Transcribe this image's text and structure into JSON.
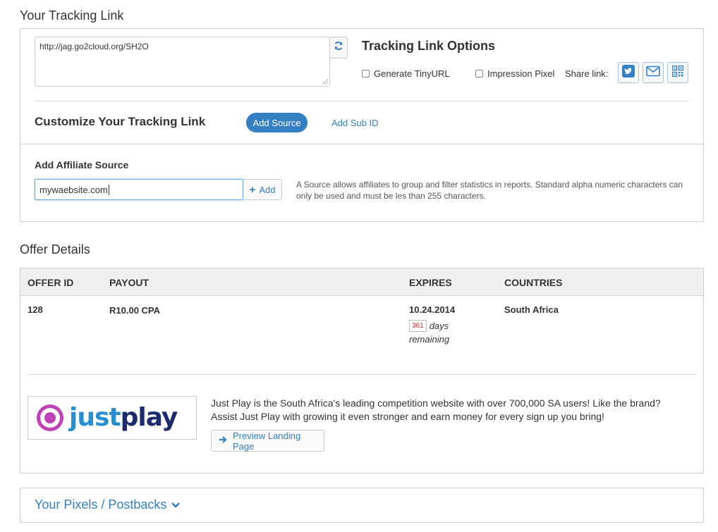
{
  "tracking": {
    "section_title": "Your Tracking Link",
    "url": "http://jag.go2cloud.org/SH2O",
    "refresh_icon": "refresh-icon",
    "options_title": "Tracking Link Options",
    "option_tinyurl": "Generate TinyURL",
    "option_impression": "Impression Pixel",
    "share_label": "Share link:",
    "share_icons": [
      "twitter-icon",
      "email-icon",
      "qr-code-icon"
    ]
  },
  "customize": {
    "title": "Customize Your Tracking Link",
    "add_source_label": "Add Source",
    "add_subid_label": "Add Sub ID"
  },
  "affiliate_source": {
    "title": "Add Affiliate Source",
    "input_value": "mywaebsite.com",
    "add_label": "Add",
    "help_text": "A Source allows affiliates to group and filter statistics in reports. Standard alpha numeric characters can only be used and must be les than 255 characters."
  },
  "offer": {
    "section_title": "Offer Details",
    "columns": [
      "OFFER ID",
      "PAYOUT",
      "EXPIRES",
      "COUNTRIES"
    ],
    "row": {
      "offer_id": "128",
      "payout": "R10.00 CPA",
      "expires": "10.24.2014",
      "days_count": "361",
      "days_word": "days",
      "remaining_word": "remaining",
      "countries": "South Africa"
    },
    "logo_text": "justplay",
    "description": "Just Play is the South Africa's leading competition website with over 700,000 SA users! Like the brand? Assist Just Play with growing it even stronger and earn money for every sign up you bring!",
    "preview_label": "Preview Landing Page"
  },
  "pixels": {
    "title": "Your Pixels / Postbacks"
  },
  "colors": {
    "accent": "#3480c3",
    "badge_red": "#d0342c",
    "logo_purple": "#c042b8",
    "logo_navy": "#1c2a6e"
  }
}
